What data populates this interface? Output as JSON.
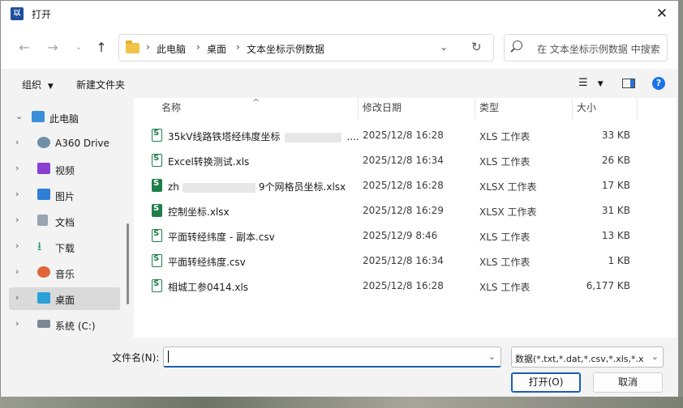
{
  "window": {
    "title": "打开",
    "app_icon_text": "以"
  },
  "nav": {
    "breadcrumbs": [
      "此电脑",
      "桌面",
      "文本坐标示例数据"
    ],
    "search_placeholder": "在 文本坐标示例数据 中搜索"
  },
  "toolbar": {
    "organize_label": "组织",
    "new_folder_label": "新建文件夹"
  },
  "sidebar": {
    "items": [
      {
        "label": "此电脑",
        "icon": "monitor-icon",
        "expanded": true
      },
      {
        "label": "A360 Drive",
        "icon": "cloud-drive-icon"
      },
      {
        "label": "视频",
        "icon": "video-icon"
      },
      {
        "label": "图片",
        "icon": "picture-icon"
      },
      {
        "label": "文档",
        "icon": "document-icon"
      },
      {
        "label": "下载",
        "icon": "download-icon"
      },
      {
        "label": "音乐",
        "icon": "music-icon"
      },
      {
        "label": "桌面",
        "icon": "desktop-icon",
        "selected": true
      },
      {
        "label": "系统 (C:)",
        "icon": "drive-icon"
      }
    ]
  },
  "columns": {
    "name": "名称",
    "date": "修改日期",
    "type": "类型",
    "size": "大小"
  },
  "files": [
    {
      "name": "35kV线路铁塔经纬度坐标",
      "name_suffix": "....",
      "redacted": true,
      "date": "2025/12/8 16:28",
      "type": "XLS 工作表",
      "size": "33 KB",
      "icon": "excel-xls-icon"
    },
    {
      "name": "Excel转换测试.xls",
      "date": "2025/12/8 16:34",
      "type": "XLS 工作表",
      "size": "26 KB",
      "icon": "excel-xls-icon"
    },
    {
      "name": "zh",
      "name_suffix": "9个网格员坐标.xlsx",
      "redacted": true,
      "date": "2025/12/8 16:28",
      "type": "XLSX 工作表",
      "size": "17 KB",
      "icon": "excel-xlsx-icon"
    },
    {
      "name": "控制坐标.xlsx",
      "date": "2025/12/8 16:29",
      "type": "XLSX 工作表",
      "size": "31 KB",
      "icon": "excel-xlsx-icon"
    },
    {
      "name": "平面转经纬度 - 副本.csv",
      "date": "2025/12/9 8:46",
      "type": "XLS 工作表",
      "size": "13 KB",
      "icon": "excel-xls-icon"
    },
    {
      "name": "平面转经纬度.csv",
      "date": "2025/12/8 16:34",
      "type": "XLS 工作表",
      "size": "1 KB",
      "icon": "excel-xls-icon"
    },
    {
      "name": "相城工参0414.xls",
      "date": "2025/12/8 16:28",
      "type": "XLS 工作表",
      "size": "6,177 KB",
      "icon": "excel-xls-icon"
    }
  ],
  "bottom": {
    "filename_label": "文件名(N):",
    "filename_value": "",
    "filter_selected": "数据(*.txt,*.dat,*.csv,*.xls,*.xlsx)",
    "open_label": "打开(O)",
    "cancel_label": "取消"
  },
  "colors": {
    "accent": "#1a5fb4",
    "excel_green": "#1e7e4a",
    "folder": "#f3c24a"
  }
}
